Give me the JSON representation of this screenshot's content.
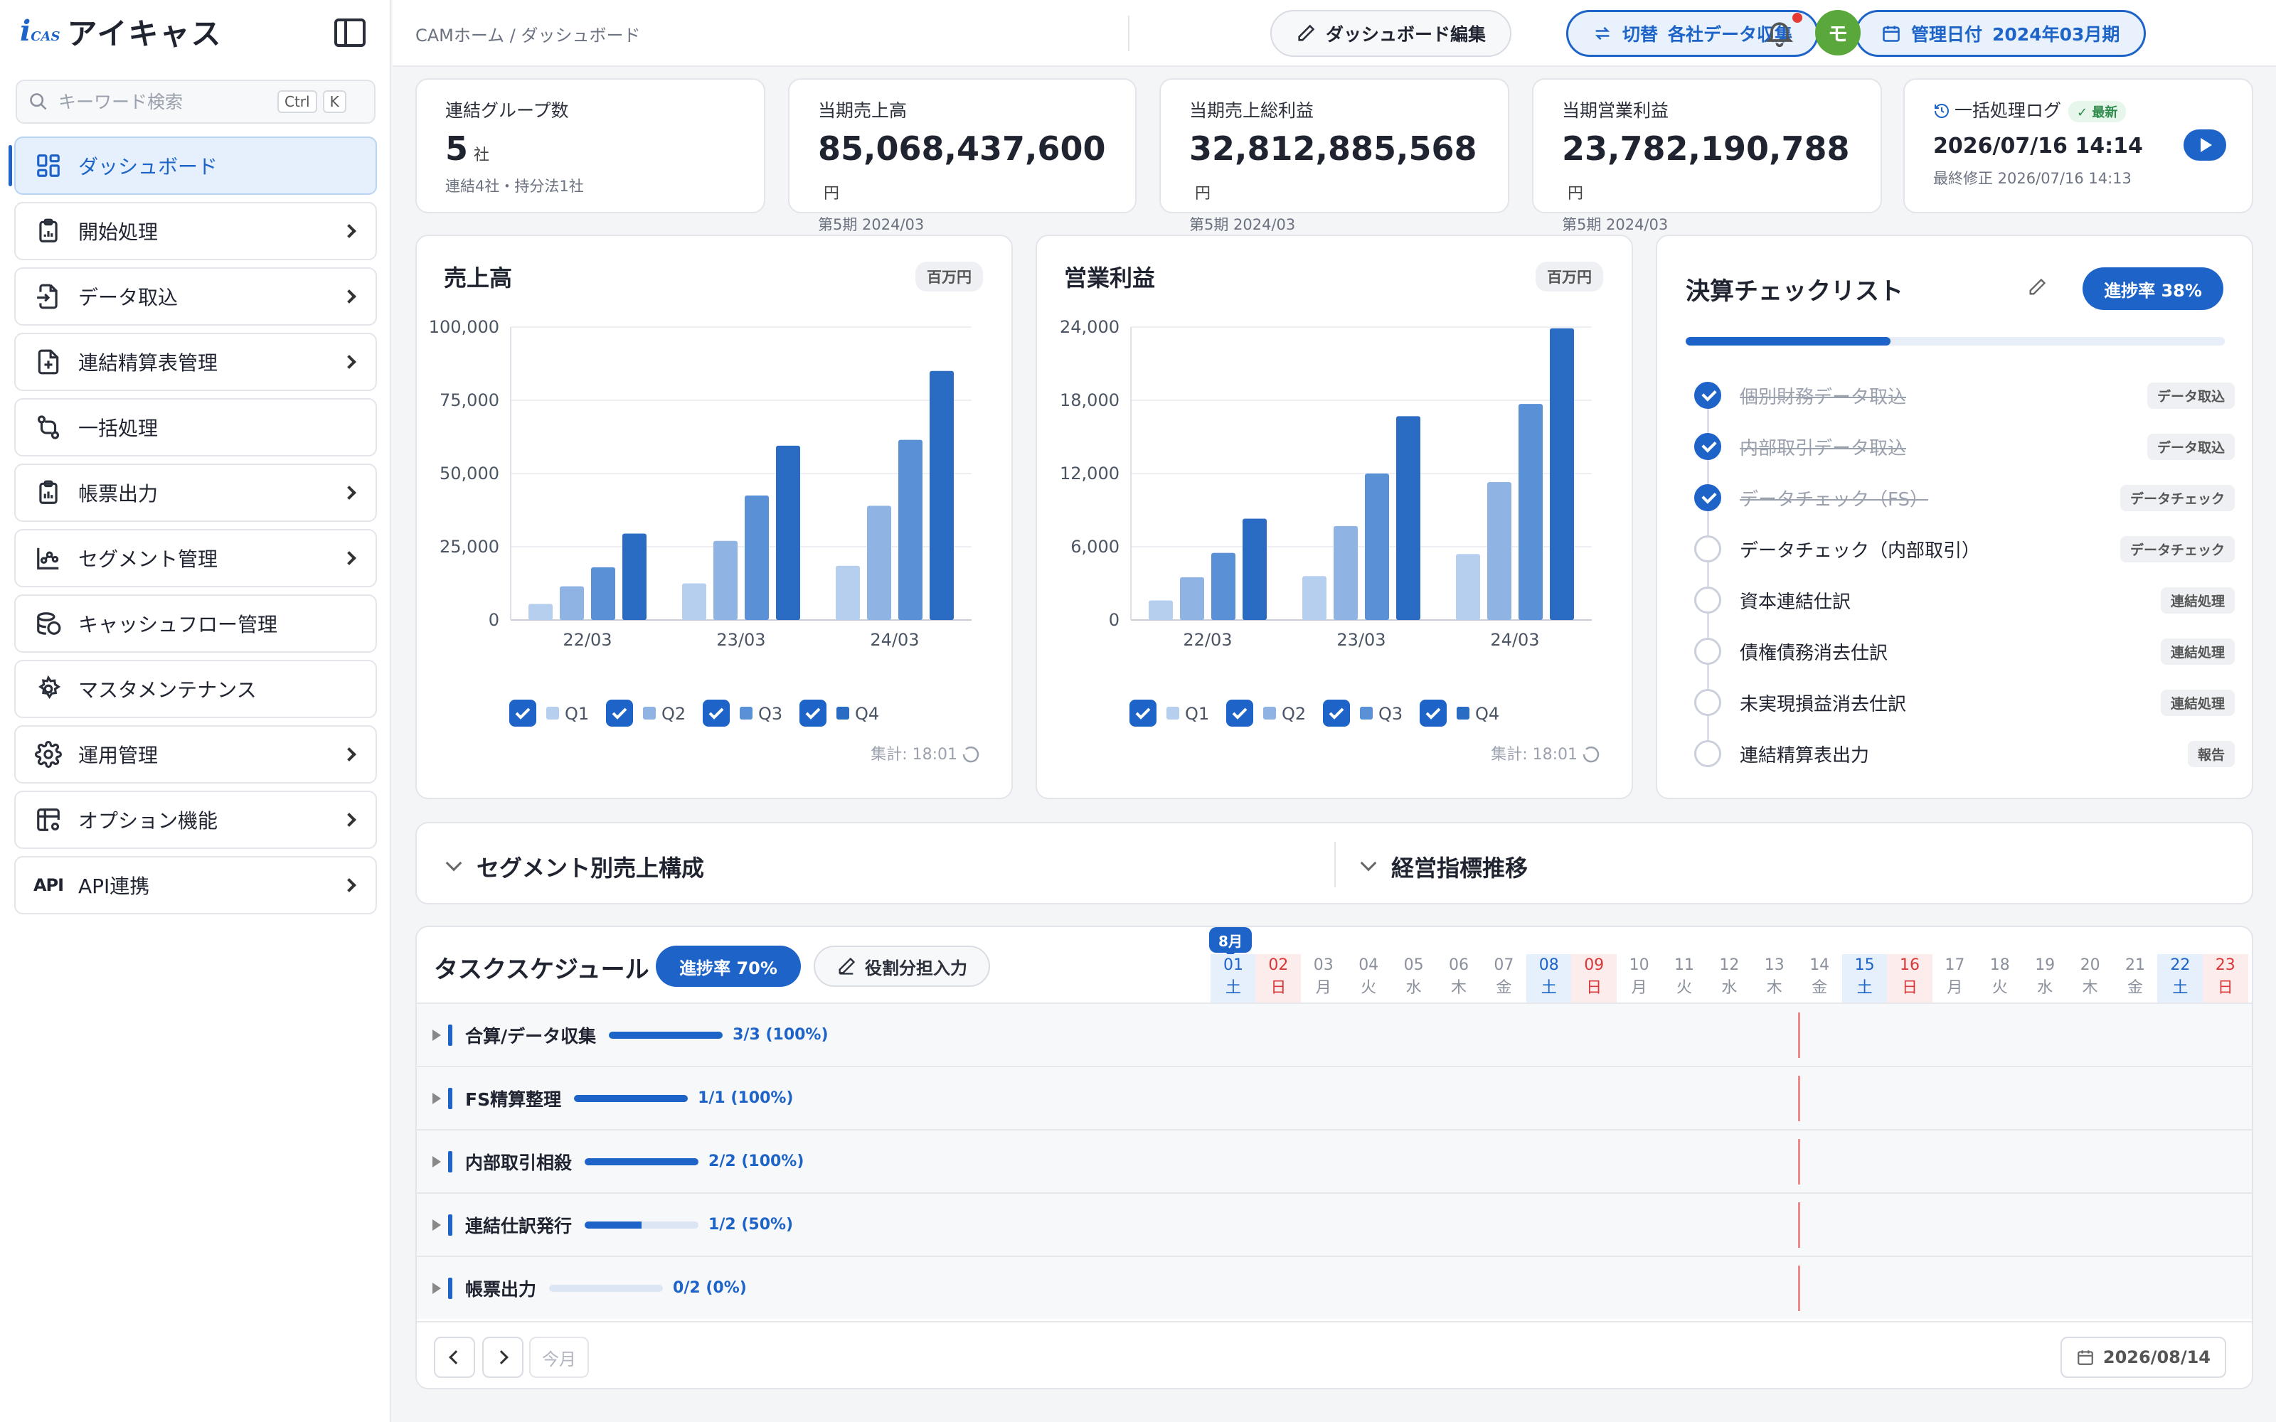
{
  "app": {
    "logo_mark": "i",
    "logo_mark_sub": "CAS",
    "logo_text": "アイキャス"
  },
  "search": {
    "placeholder": "キーワード検索",
    "kbd1": "Ctrl",
    "kbd2": "K"
  },
  "sidebar": {
    "items": [
      {
        "label": "ダッシュボード",
        "icon": "dashboard-icon"
      },
      {
        "label": "開始処理",
        "icon": "clipboard-icon"
      },
      {
        "label": "データ取込",
        "icon": "file-import-icon"
      },
      {
        "label": "連結精算表管理",
        "icon": "file-plus-icon"
      },
      {
        "label": "一括処理",
        "icon": "git-compare-icon"
      },
      {
        "label": "帳票出力",
        "icon": "report-icon"
      },
      {
        "label": "セグメント管理",
        "icon": "segment-chart-icon"
      },
      {
        "label": "キャッシュフロー管理",
        "icon": "coins-icon"
      },
      {
        "label": "マスタメンテナンス",
        "icon": "master-gear-icon"
      },
      {
        "label": "運用管理",
        "icon": "settings-icon"
      },
      {
        "label": "オプション機能",
        "icon": "table-gear-icon"
      },
      {
        "label": "API連携",
        "icon": "api-icon",
        "tag": "API"
      }
    ]
  },
  "topbar": {
    "breadcrumb": "CAMホーム  /  ダッシュボード",
    "edit_label": "ダッシュボード編集",
    "switch_label": "切替",
    "switch_value": "各社データ収集",
    "date_label": "管理日付",
    "date_value": "2024年03月期",
    "avatar": "モ"
  },
  "kpis": [
    {
      "label": "連結グループ数",
      "value": "5",
      "unit": "社",
      "sub": "連結4社・持分法1社"
    },
    {
      "label": "当期売上高",
      "value": "85,068,437,600",
      "unit": "円",
      "sub": "第5期 2024/03"
    },
    {
      "label": "当期売上総利益",
      "value": "32,812,885,568",
      "unit": "円",
      "sub": "第5期 2024/03"
    },
    {
      "label": "当期営業利益",
      "value": "23,782,190,788",
      "unit": "円",
      "sub": "第5期 2024/03"
    }
  ],
  "batch_log": {
    "label": "一括処理ログ",
    "badge": "最新",
    "datetime": "2026/07/16 14:14",
    "sub": "最終修正 2026/07/16 14:13"
  },
  "chart_data": [
    {
      "type": "bar",
      "title": "売上高",
      "unit_label": "百万円",
      "categories": [
        "22/03",
        "23/03",
        "24/03"
      ],
      "yticks": [
        "0",
        "25,000",
        "50,000",
        "75,000",
        "100,000"
      ],
      "ylim": [
        0,
        100000
      ],
      "series": [
        {
          "name": "Q1",
          "values": [
            5500,
            12500,
            18500
          ]
        },
        {
          "name": "Q2",
          "values": [
            11500,
            27000,
            39000
          ]
        },
        {
          "name": "Q3",
          "values": [
            18000,
            42500,
            61500
          ]
        },
        {
          "name": "Q4",
          "values": [
            29500,
            59500,
            85000
          ]
        }
      ],
      "footer": "集計: 18:01"
    },
    {
      "type": "bar",
      "title": "営業利益",
      "unit_label": "百万円",
      "categories": [
        "22/03",
        "23/03",
        "24/03"
      ],
      "yticks": [
        "0",
        "6,000",
        "12,000",
        "18,000",
        "24,000"
      ],
      "ylim": [
        0,
        24000
      ],
      "series": [
        {
          "name": "Q1",
          "values": [
            1600,
            3600,
            5400
          ]
        },
        {
          "name": "Q2",
          "values": [
            3500,
            7700,
            11300
          ]
        },
        {
          "name": "Q3",
          "values": [
            5500,
            12000,
            17700
          ]
        },
        {
          "name": "Q4",
          "values": [
            8300,
            16700,
            23900
          ]
        }
      ],
      "footer": "集計: 18:01"
    }
  ],
  "series_colors": [
    "#b7cfee",
    "#8fb4e3",
    "#5a90d6",
    "#2a6cc4"
  ],
  "checklist": {
    "title": "決算チェックリスト",
    "progress_label": "進捗率 38%",
    "progress": 0.38,
    "items": [
      {
        "text": "個別財務データ取込",
        "tag": "データ取込",
        "done": true
      },
      {
        "text": "内部取引データ取込",
        "tag": "データ取込",
        "done": true
      },
      {
        "text": "データチェック（FS）",
        "tag": "データチェック",
        "done": true
      },
      {
        "text": "データチェック（内部取引）",
        "tag": "データチェック",
        "done": false
      },
      {
        "text": "資本連結仕訳",
        "tag": "連結処理",
        "done": false
      },
      {
        "text": "債権債務消去仕訳",
        "tag": "連結処理",
        "done": false
      },
      {
        "text": "未実現損益消去仕訳",
        "tag": "連結処理",
        "done": false
      },
      {
        "text": "連結精算表出力",
        "tag": "報告",
        "done": false
      }
    ]
  },
  "collapsed": {
    "segment": "セグメント別売上構成",
    "kpi_trend": "経営指標推移"
  },
  "schedule": {
    "title": "タスクスケジュール",
    "progress_label": "進捗率  70%",
    "role_label": "役割分担入力",
    "month": "8月",
    "days": [
      {
        "d": "01",
        "w": "土",
        "t": "sat"
      },
      {
        "d": "02",
        "w": "日",
        "t": "sun"
      },
      {
        "d": "03",
        "w": "月"
      },
      {
        "d": "04",
        "w": "火"
      },
      {
        "d": "05",
        "w": "水"
      },
      {
        "d": "06",
        "w": "木"
      },
      {
        "d": "07",
        "w": "金"
      },
      {
        "d": "08",
        "w": "土",
        "t": "sat"
      },
      {
        "d": "09",
        "w": "日",
        "t": "sun"
      },
      {
        "d": "10",
        "w": "月"
      },
      {
        "d": "11",
        "w": "火"
      },
      {
        "d": "12",
        "w": "水"
      },
      {
        "d": "13",
        "w": "木"
      },
      {
        "d": "14",
        "w": "金"
      },
      {
        "d": "15",
        "w": "土",
        "t": "sat"
      },
      {
        "d": "16",
        "w": "日",
        "t": "sun"
      },
      {
        "d": "17",
        "w": "月"
      },
      {
        "d": "18",
        "w": "火"
      },
      {
        "d": "19",
        "w": "水"
      },
      {
        "d": "20",
        "w": "木"
      },
      {
        "d": "21",
        "w": "金"
      },
      {
        "d": "22",
        "w": "土",
        "t": "sat"
      },
      {
        "d": "23",
        "w": "日",
        "t": "sun"
      }
    ],
    "tasks": [
      {
        "name": "合算/データ収集",
        "progress": 1.0,
        "label": "3/3  (100%)"
      },
      {
        "name": "FS精算整理",
        "progress": 1.0,
        "label": "1/1  (100%)"
      },
      {
        "name": "内部取引相殺",
        "progress": 1.0,
        "label": "2/2  (100%)"
      },
      {
        "name": "連結仕訳発行",
        "progress": 0.5,
        "label": "1/2  (50%)"
      },
      {
        "name": "帳票出力",
        "progress": 0.0,
        "label": "0/2  (0%)"
      }
    ],
    "today_label": "今月",
    "current_date": "2026/08/14"
  }
}
